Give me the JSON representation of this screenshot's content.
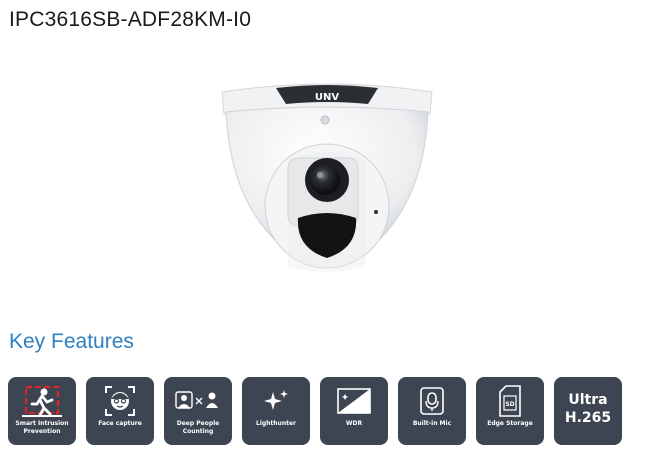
{
  "model": "IPC3616SB-ADF28KM-I0",
  "camera": {
    "brand": "UNV"
  },
  "features_heading": "Key Features",
  "features": [
    {
      "label": "Smart Intrusion Prevention",
      "icon": "intrusion-icon"
    },
    {
      "label": "Face capture",
      "icon": "face-icon"
    },
    {
      "label": "Deep People Counting",
      "icon": "people-counting-icon"
    },
    {
      "label": "Lighthunter",
      "icon": "sparkle-icon"
    },
    {
      "label": "WDR",
      "icon": "wdr-icon"
    },
    {
      "label": "Built-in Mic",
      "icon": "mic-icon"
    },
    {
      "label": "Edge Storage",
      "icon": "sd-card-icon"
    },
    {
      "label_line1": "Ultra",
      "label_line2": "H.265"
    }
  ],
  "colors": {
    "heading_blue": "#2f7fc1",
    "tile_bg": "#3d4552",
    "alert_red": "#e0242a"
  }
}
